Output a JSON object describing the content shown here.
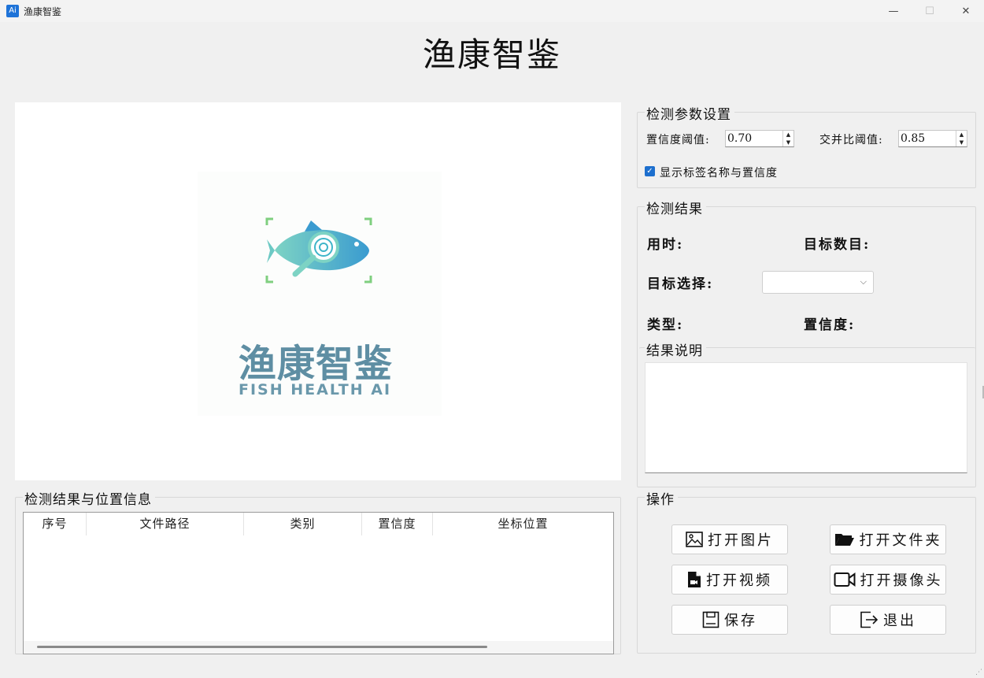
{
  "window": {
    "title": "渔康智鉴",
    "icon_text": "Ai",
    "minimize_glyph": "—",
    "maximize_glyph": "☐",
    "close_glyph": "✕"
  },
  "header": {
    "title": "渔康智鉴"
  },
  "logo": {
    "cn_text": "渔康智鉴",
    "en_text": "FISH HEALTH AI",
    "colors": {
      "fish_from": "#3fb5c9",
      "fish_to": "#7dd3c4",
      "frame": "#7fcf7f",
      "text": "#5e8ea3"
    }
  },
  "params": {
    "group_title": "检测参数设置",
    "confidence_label": "置信度阈值:",
    "confidence_value": "0.70",
    "iou_label": "交并比阈值:",
    "iou_value": "0.85",
    "show_label_checkbox": "显示标签名称与置信度",
    "show_label_checked": true
  },
  "results": {
    "group_title": "检测结果",
    "time_label": "用时:",
    "count_label": "目标数目:",
    "target_select_label": "目标选择:",
    "target_select_value": "",
    "type_label": "类型:",
    "confidence_label": "置信度:",
    "desc_label": "结果说明"
  },
  "table": {
    "group_title": "检测结果与位置信息",
    "columns": [
      "序号",
      "文件路径",
      "类别",
      "置信度",
      "坐标位置"
    ],
    "rows": []
  },
  "actions": {
    "group_title": "操作",
    "open_image": "打开图片",
    "open_folder": "打开文件夹",
    "open_video": "打开视频",
    "open_camera": "打开摄像头",
    "save": "保存",
    "exit": "退出"
  }
}
